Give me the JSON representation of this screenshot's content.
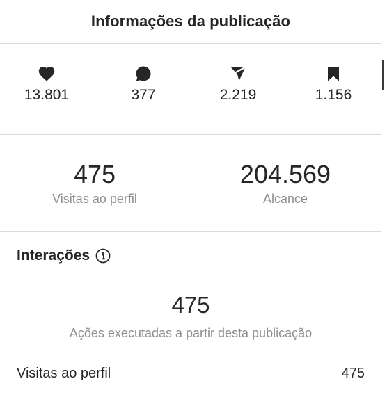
{
  "header": {
    "title": "Informações da publicação"
  },
  "engagement": [
    {
      "icon": "heart-icon",
      "value": "13.801"
    },
    {
      "icon": "comment-icon",
      "value": "377"
    },
    {
      "icon": "share-icon",
      "value": "2.219"
    },
    {
      "icon": "bookmark-icon",
      "value": "1.156"
    }
  ],
  "reach": {
    "profile_visits": {
      "value": "475",
      "label": "Visitas ao perfil"
    },
    "reach": {
      "value": "204.569",
      "label": "Alcance"
    }
  },
  "interactions": {
    "title": "Interações",
    "total": "475",
    "description": "Ações executadas a partir desta publicação",
    "rows": [
      {
        "label": "Visitas ao perfil",
        "value": "475"
      }
    ]
  },
  "colors": {
    "text": "#262626",
    "secondary_text": "#8e8e8e",
    "divider": "#dbdbdb"
  }
}
